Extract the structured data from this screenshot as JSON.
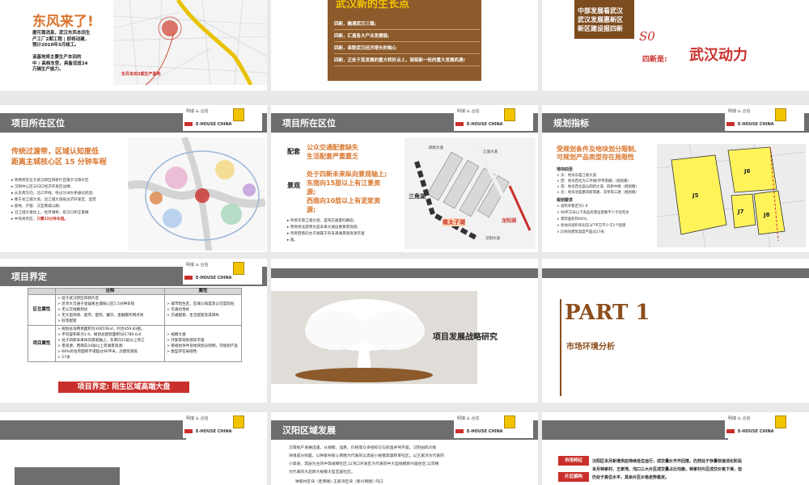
{
  "s1": {
    "title": "东风来了!",
    "body": [
      "据可靠消息，武汉东风本田生",
      "产工厂2期工程 | 即将动建，",
      "预计2010年3月竣工。",
      "",
      "该基地将主要生产本田的",
      "中 / 高档车型，具备双班24",
      "万辆生产能力。"
    ],
    "map_label": "东风本田2期生产基地"
  },
  "s2": {
    "title": "武汉新的生长点",
    "rows": [
      "四新，融通武汉三镇;",
      "四新，汇造各大产业发展链;",
      "四新，串联武汉经济增长的轴心",
      "四新，正处于其发展的重大转折点上，面临新一轮的重大发展机遇!"
    ]
  },
  "s3": {
    "box": [
      "中部发展看武汉",
      "武汉发展惠新区",
      "新区建设报四新"
    ],
    "num": "S0",
    "prefix": "四新是:",
    "headline": "武汉动力"
  },
  "logo": {
    "brand": "明瑞 & 合信",
    "company": "E-HOUSE CHINA"
  },
  "s4": {
    "header": "项目所在区位",
    "headline": [
      "传统过渡带，区域认知度低",
      "距离主城核心区 15 分钟车程"
    ],
    "bullets": [
      "项目所在位于武汉新区四新片区属于汉阳片区",
      "汉阳中心区与归口经济开发区边缘;",
      "从东南方向，沿三环线，经过沙洲大桥通达武昌;",
      "南于龙江城大道，沿江城大道抵达济开发区、直奔",
      "基地、沪蓉、汉宜南城公路;",
      "沿江城大道往上，经月湖桥、航汉口和王家墩",
      "中央商务区，只需15分钟车程。"
    ],
    "highlight": "只需15分钟车程。"
  },
  "s5": {
    "header": "项目所在区位",
    "label1": "配套",
    "text1": [
      "公众交通配套缺失",
      "生活配套严重匮乏"
    ],
    "label2": "景观",
    "text2": [
      "处于四新未来纵向景观轴上;",
      "东南向15层以上有江景资",
      "源;",
      "西南向10层以上有泥浆资",
      "源;"
    ],
    "small": [
      "项目东南江城大道，是快交通量的路段;",
      "周地块北部周也是未来大湖边重要景观道;",
      "项目西南的太子湖属于的未来湖景观资源丰富",
      "富。"
    ],
    "map_labels": [
      "四新大道",
      "江城大道",
      "三角湖",
      "南太子湖",
      "龙阳湖",
      "汉阳大道"
    ]
  },
  "s6": {
    "header": "规划指标",
    "headline": [
      "受规划条件及地块划分限制,",
      "可规划产品类型存在局限性"
    ],
    "sec1": "地块四至",
    "items1": [
      "东：地块东临江城大道",
      "西：地块西北为三环线(环草南路)（规划路）",
      "南：地块西北面与四新大道、四新中路（规划路）",
      "北：地块北临墨四新南路、双草南三路（规划路）"
    ],
    "sec2": "规划要求",
    "items2": [
      "容积率暂定为1.9",
      "90平方米以下商品房建设套数不少于住宅总",
      "建筑面积的66%;",
      "各地块容积率比较3户平方不少于1个配建",
      "J5地块建筑高度不超过27米;"
    ],
    "parcels": [
      "J6",
      "J5",
      "J7",
      "J8"
    ]
  },
  "s7": {
    "header": "项目界定",
    "col1": "诠释",
    "col2": "属性",
    "row1_label": "区位属性",
    "row1_c1": [
      "处于武汉新区四新片区",
      "近邻大交通于退居离主城核心区1.5分钟车程",
      "无公交线路到达",
      "无大型商场、超市、医院、餐饮、金融服务网点尚",
      "较等配套"
    ],
    "row1_c2": [
      "城市暗生区，区域认知度及认可度较低",
      "可通达性好",
      "交通配套、生活配套及其缺失"
    ],
    "row2_label": "项目属性",
    "row2_c1": [
      "规划总净用地面积为306556㎡，约合459.83亩，",
      "平均容积率为1.9，规划总建筑面积581780.6㎡",
      "处于四新未来纵向景观轴上，东南向15层以上有江",
      "景资源，西南向10层以上有湖景资源;",
      "66%的住宅面积不得超过90平米，J5建筑限高",
      "27米"
    ],
    "row2_c2": [
      "规模大盘",
      "外部景观资源较丰富",
      "受规划条件及地块划分限制，可规划产品",
      "类型存在局限性"
    ],
    "banner": "项目界定: 陌生区域高端大盘"
  },
  "s8": {
    "title": "项目发展战略研究"
  },
  "s9": {
    "part": "PART 1",
    "subtitle": "市场环境分析"
  },
  "s11": {
    "header": "汉阳区域发展",
    "para": [
      "汉阳地产发展迅速。从规模、品质、价格等众多指标已与武昌并驾齐驱。汉阳由四大板",
      "块组成分别是，以钟家村核心商圈为代表的以高层小规模高容积率社区。以王家湾为代表的",
      "小高层、高层为主的中等规模社区;以沌口开发区为代表的中大型规模新兴居住区;以郊楼",
      "为代表的大品牌大规模大型宜居社区。"
    ],
    "last": "钟家村区块（老商圈）·王家湾区块（新兴商圈）·沌口"
  },
  "s12": {
    "tags": [
      "市场特征",
      "片区解构"
    ],
    "text": [
      "汉阳区本月新增供应持续低位运行，成交量价齐齐回落，仍然处于存量快速消化阶段",
      "本月钟家村、王家湾、沌口三大片区成交量占比均衡，钟家村片区成交价格下滑，但",
      "仍处于高位水平，其余片区价格走势稳定。"
    ]
  }
}
